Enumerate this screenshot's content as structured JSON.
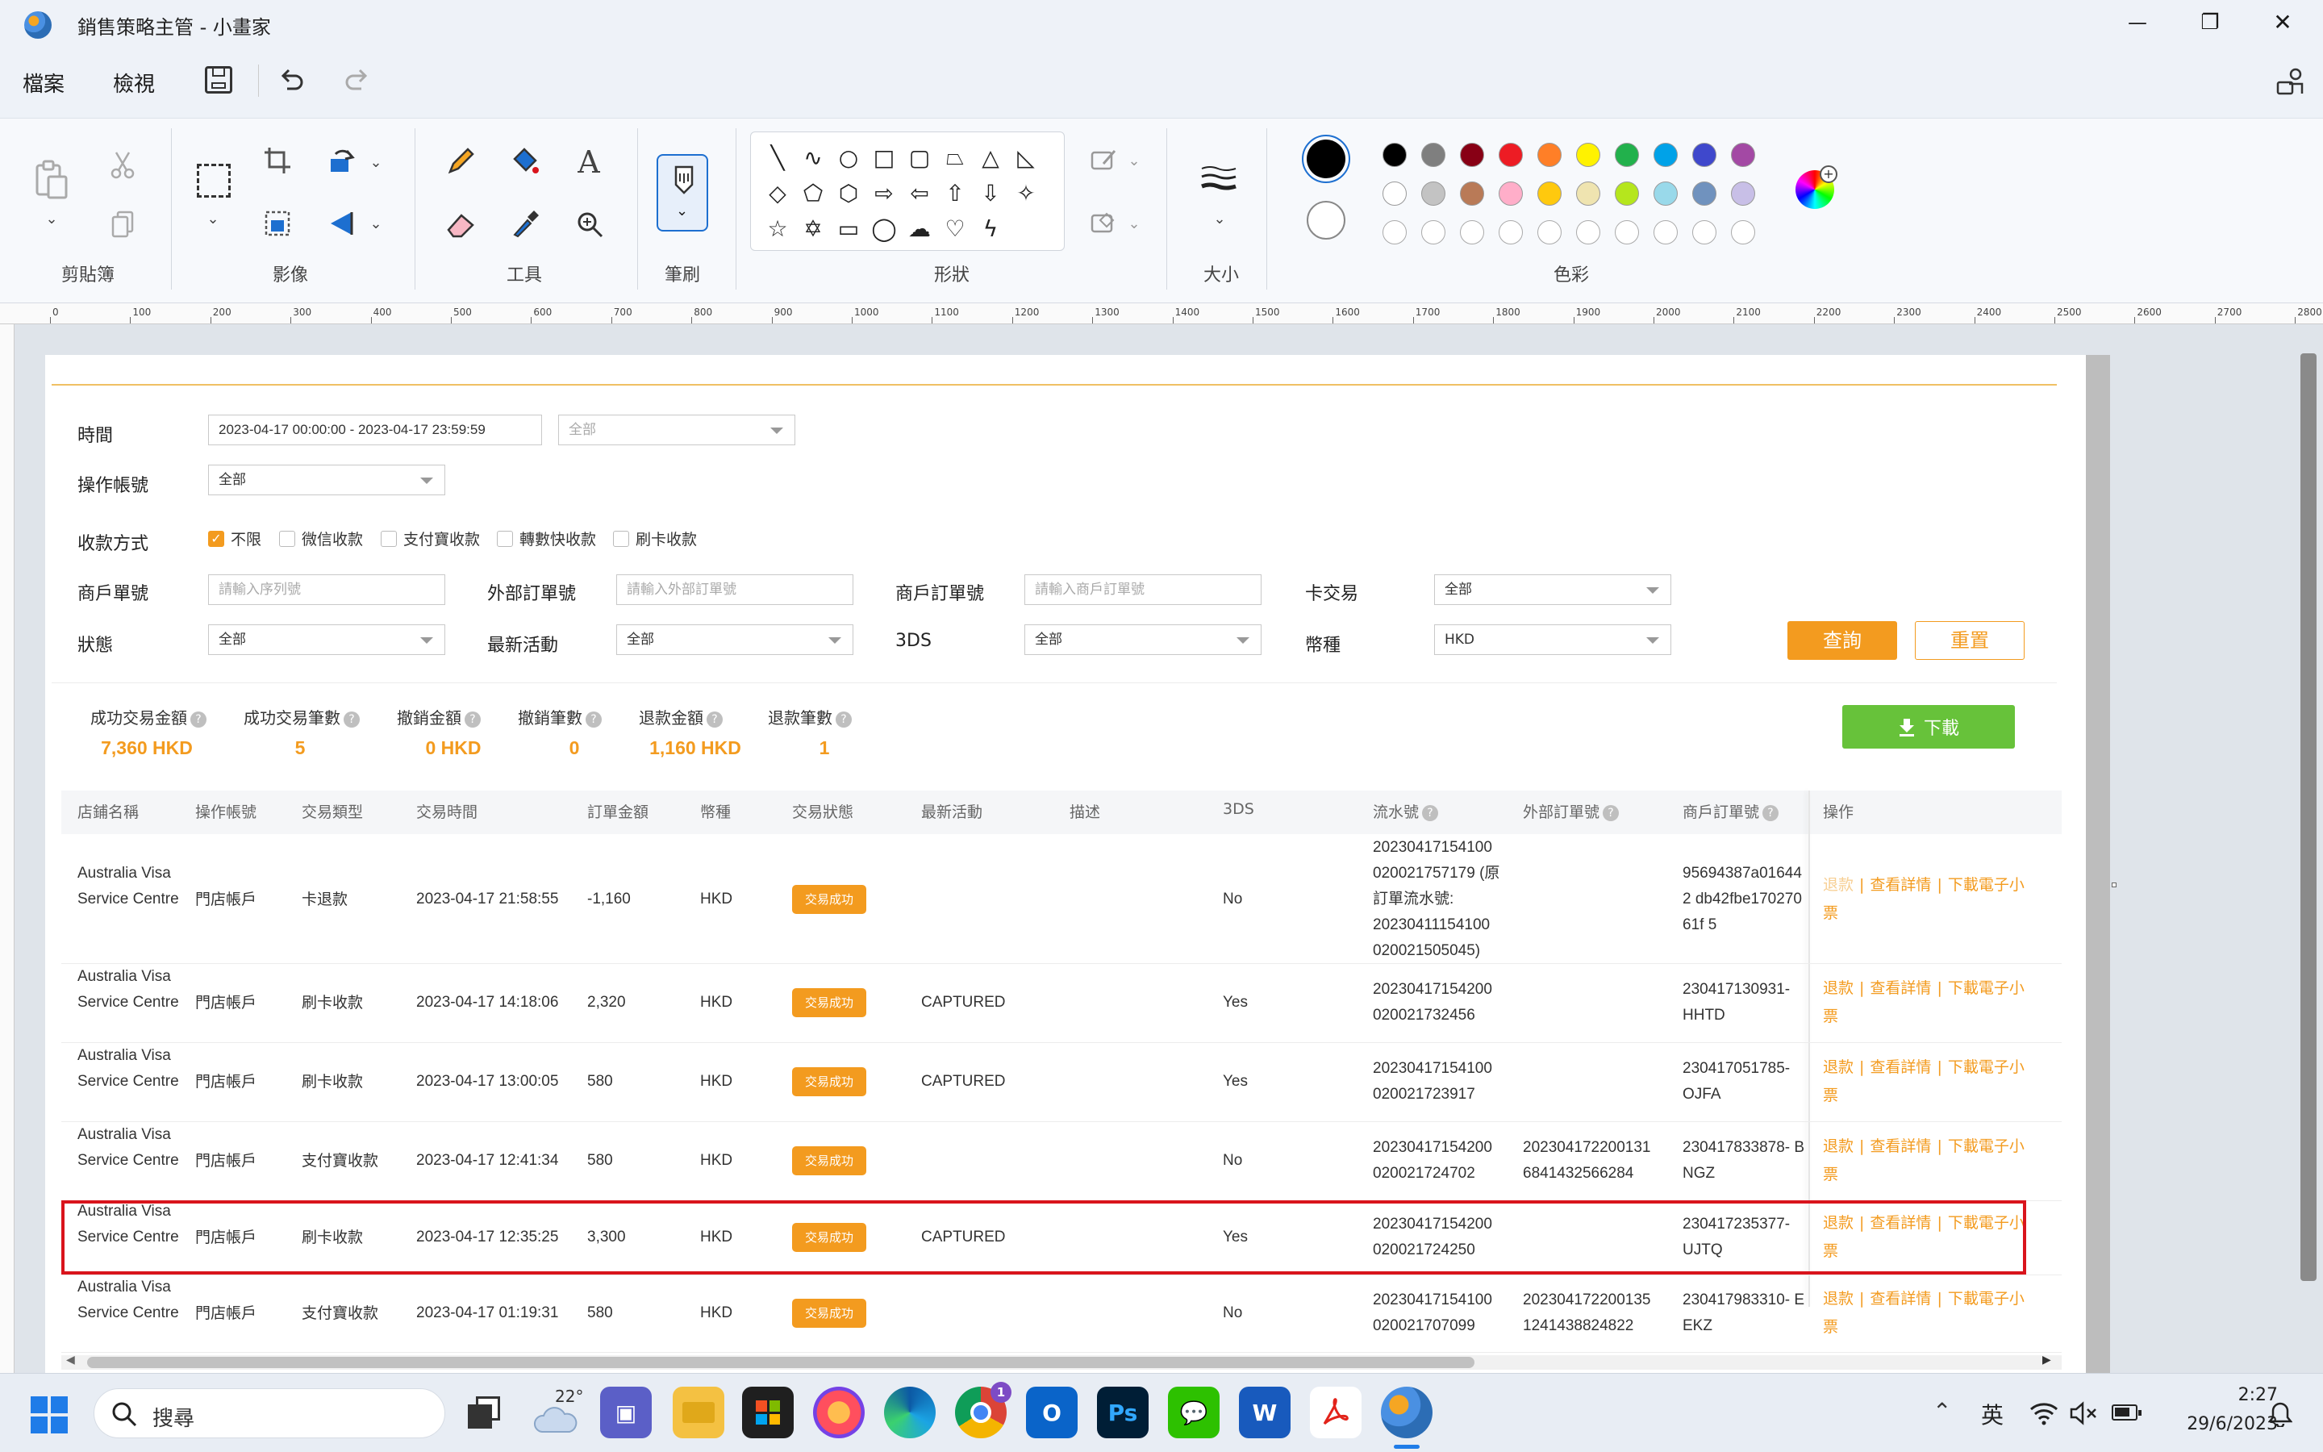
{
  "window": {
    "title": "銷售策略主管 - 小畫家",
    "minimize_glyph": "—",
    "restore_glyph": "❐",
    "close_glyph": "✕"
  },
  "menu": {
    "file": "檔案",
    "view": "檢視"
  },
  "ribbon": {
    "clipboard": "剪貼簿",
    "image": "影像",
    "tools": "工具",
    "brushes": "筆刷",
    "shapes": "形狀",
    "size": "大小",
    "colors": "色彩"
  },
  "palette_row1": [
    "#000000",
    "#7f7f7f",
    "#880015",
    "#ed1c24",
    "#ff7f27",
    "#fff200",
    "#22b14c",
    "#00a2e8",
    "#3f48cc",
    "#a349a4"
  ],
  "palette_row2": [
    "#ffffff",
    "#c3c3c3",
    "#b97a57",
    "#ffaec9",
    "#ffc90e",
    "#efe4b0",
    "#b5e61d",
    "#99d9ea",
    "#7092be",
    "#c8bfe7"
  ],
  "ruler_ticks": [
    "0",
    "100",
    "200",
    "300",
    "400",
    "500",
    "600",
    "700",
    "800",
    "900",
    "1000",
    "1100",
    "1200",
    "1300",
    "1400",
    "1500",
    "1600",
    "1700",
    "1800",
    "1900",
    "2000",
    "2100",
    "2200",
    "2300",
    "2400",
    "2500",
    "2600",
    "2700",
    "2800"
  ],
  "filters": {
    "time_label": "時間",
    "time_value": "2023-04-17 00:00:00 - 2023-04-17 23:59:59",
    "time_select": "全部",
    "account_label": "操作帳號",
    "account_value": "全部",
    "payment_label": "收款方式",
    "payment_options": [
      "不限",
      "微信收款",
      "支付寶收款",
      "轉數快收款",
      "刷卡收款"
    ],
    "merchant_no_label": "商戶單號",
    "merchant_no_ph": "請輸入序列號",
    "ext_order_label": "外部訂單號",
    "ext_order_ph": "請輸入外部訂單號",
    "merchant_order_label": "商戶訂單號",
    "merchant_order_ph": "請輸入商戶訂單號",
    "card_tx_label": "卡交易",
    "card_tx_value": "全部",
    "status_label": "狀態",
    "status_value": "全部",
    "latest_label": "最新活動",
    "latest_value": "全部",
    "threeds_label": "3DS",
    "threeds_value": "全部",
    "currency_label": "幣種",
    "currency_value": "HKD",
    "query_btn": "查詢",
    "reset_btn": "重置"
  },
  "stats": [
    {
      "label": "成功交易金額",
      "value": "7,360 HKD"
    },
    {
      "label": "成功交易筆數",
      "value": "5"
    },
    {
      "label": "撤銷金額",
      "value": "0 HKD"
    },
    {
      "label": "撤銷筆數",
      "value": "0"
    },
    {
      "label": "退款金額",
      "value": "1,160 HKD"
    },
    {
      "label": "退款筆數",
      "value": "1"
    }
  ],
  "download_btn": "下載",
  "table": {
    "headers": [
      "店鋪名稱",
      "操作帳號",
      "交易類型",
      "交易時間",
      "訂單金額",
      "幣種",
      "交易狀態",
      "最新活動",
      "描述",
      "3DS",
      "流水號",
      "外部訂單號",
      "商戶訂單號",
      "操作"
    ],
    "ops": {
      "refund": "退款",
      "details": "查看詳情",
      "receipt": "下載電子小票",
      "sep": "|"
    },
    "rows": [
      {
        "store": "Australia Visa Service Centre",
        "account": "門店帳戶",
        "type": "卡退款",
        "time": "2023-04-17 21:58:55",
        "amount": "-1,160",
        "currency": "HKD",
        "status": "交易成功",
        "latest": "",
        "desc": "",
        "threeds": "No",
        "serial": "20230417154100 020021757179 (原訂單流水號: 20230411154100 020021505045)",
        "ext": "",
        "merchant": "95694387a016442 db42fbe17027061f 5"
      },
      {
        "store": "Australia Visa Service Centre",
        "account": "門店帳戶",
        "type": "刷卡收款",
        "time": "2023-04-17 14:18:06",
        "amount": "2,320",
        "currency": "HKD",
        "status": "交易成功",
        "latest": "CAPTURED",
        "desc": "",
        "threeds": "Yes",
        "serial": "20230417154200 020021732456",
        "ext": "",
        "merchant": "230417130931- HHTD"
      },
      {
        "store": "Australia Visa Service Centre",
        "account": "門店帳戶",
        "type": "刷卡收款",
        "time": "2023-04-17 13:00:05",
        "amount": "580",
        "currency": "HKD",
        "status": "交易成功",
        "latest": "CAPTURED",
        "desc": "",
        "threeds": "Yes",
        "serial": "20230417154100 020021723917",
        "ext": "",
        "merchant": "230417051785- OJFA"
      },
      {
        "store": "Australia Visa Service Centre",
        "account": "門店帳戶",
        "type": "支付寶收款",
        "time": "2023-04-17 12:41:34",
        "amount": "580",
        "currency": "HKD",
        "status": "交易成功",
        "latest": "",
        "desc": "",
        "threeds": "No",
        "serial": "20230417154200 020021724702",
        "ext": "202304172200131 6841432566284",
        "merchant": "230417833878- BNGZ"
      },
      {
        "store": "Australia Visa Service Centre",
        "account": "門店帳戶",
        "type": "刷卡收款",
        "time": "2023-04-17 12:35:25",
        "amount": "3,300",
        "currency": "HKD",
        "status": "交易成功",
        "latest": "CAPTURED",
        "desc": "",
        "threeds": "Yes",
        "serial": "20230417154200 020021724250",
        "ext": "",
        "merchant": "230417235377- UJTQ"
      },
      {
        "store": "Australia Visa Service Centre",
        "account": "門店帳戶",
        "type": "支付寶收款",
        "time": "2023-04-17 01:19:31",
        "amount": "580",
        "currency": "HKD",
        "status": "交易成功",
        "latest": "",
        "desc": "",
        "threeds": "No",
        "serial": "20230417154100 020021707099",
        "ext": "202304172200135 1241438824822",
        "merchant": "230417983310- EEKZ"
      }
    ]
  },
  "taskbar": {
    "search": "搜尋",
    "weather": "22°",
    "ime": "英",
    "time": "2:27",
    "date": "29/6/2023",
    "chrome_badge": "1",
    "outlook_letter": "O",
    "ps_letter": "Ps",
    "word_letter": "W",
    "chat_glyph": "💬"
  },
  "colors": {
    "accent": "#f39b1f",
    "download": "#67c23a",
    "highlight": "#d9141c"
  }
}
